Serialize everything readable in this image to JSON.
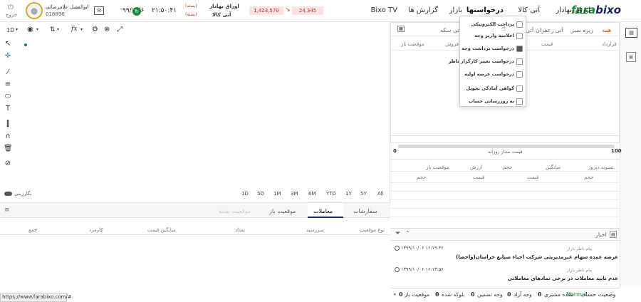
{
  "brand": {
    "part1": "fara",
    "part2": "bixo"
  },
  "menu": [
    {
      "label": "اوراق بهادار"
    },
    {
      "label": "آتی کالا"
    },
    {
      "label": "درخواستها"
    },
    {
      "label": "بازار"
    },
    {
      "label": "گزارش ها"
    },
    {
      "label": "Bixo TV"
    }
  ],
  "ticker": {
    "name1": "اوراق بهادار",
    "name2": "آتی کالا",
    "tag1": "(بسته)",
    "tag2": "(بسته)",
    "value1": "24,345",
    "value2": "1,423,570"
  },
  "clock": {
    "time": "۲۱:۵۰:۴۱",
    "date": "۹۹/۱۰/۶"
  },
  "user": {
    "name": "ابوالفضل علامرضائی",
    "code": "018896",
    "logout": "خروج"
  },
  "dropdown": {
    "items": [
      {
        "label": "پرداخت الکترونیکی"
      },
      {
        "label": "اعلامیه واریز وجه"
      },
      {
        "label": "درخواست برداشت وجه"
      },
      {
        "label": "درخواست تغییر کارگزار ناظر"
      },
      {
        "label": "درخواست عرضه اولیه"
      },
      {
        "label": "گواهی آمادگی تحویل"
      },
      {
        "label": "به روزرسانی حساب"
      }
    ]
  },
  "contract_panel": {
    "tabs": [
      "همه",
      "زیره سبز",
      "آتی زعفران",
      "آتی",
      "آتی سکه"
    ],
    "headers": [
      "قرارداد",
      "قیمت",
      "فروش",
      "موقعیت باز"
    ]
  },
  "chart": {
    "toolbar": {
      "interval": "1D",
      "fx": "fx"
    },
    "timeframes": [
      "All",
      "5Y",
      "1Y",
      "YTD",
      "6M",
      "3M",
      "1M",
      "5D",
      "1D"
    ],
    "draw_mode": "نگارزینی"
  },
  "margin": {
    "left_value": "0",
    "right_value": "100",
    "label": "قیمت مجاز روزانه"
  },
  "settle_table": {
    "row1": [
      "تسویه دیروز",
      "میانگین",
      "حجم",
      "ارزش",
      "موقعیت باز"
    ],
    "row2": [
      "حجم",
      "قیمت",
      "قیمت",
      "حجم"
    ]
  },
  "orders": {
    "tabs": [
      "سفارشات",
      "معاملات",
      "موقعیت باز",
      "موقعیت بسته"
    ],
    "headers": [
      "نوع موقعیت",
      "سررسید",
      "تعداد",
      "میانگین قیمت",
      "کارمزد",
      "جمع"
    ]
  },
  "news": {
    "title": "اخبار",
    "items": [
      {
        "source": "پیام ناظر بازار",
        "time": "۱۳۹۹/۱۰/۰۶ ۱۶:۱۹:۴۶",
        "headline": "عرضه عمده سهام غیرمدیریتی شرکت احیاء صنایع خراسان(واحصا)"
      },
      {
        "source": "پیام ناظر بازار",
        "time": "۱۳۹۹/۱۰/۰۶ ۱۶:۱۳:۵۶",
        "headline": "عدم تایید معاملات در برخی نمادهای معاملاتی"
      }
    ]
  },
  "status": {
    "account_label": "وضعیت حساب",
    "account_value": "Normal",
    "credit_label": "مانده مشتری",
    "credit_value": "0",
    "free_label": "وجه آزاد",
    "free_value": "0",
    "guarantee_label": "وجه تضمین",
    "guarantee_value": "0",
    "blocked_label": "بلوکه شده",
    "blocked_value": "0",
    "open_label": "موقعیت باز",
    "open_value": "0"
  },
  "url": "https://www.farabixo.com/#",
  "colors": {
    "brand_green": "#1b8a3c",
    "brand_navy": "#1a2a5e",
    "accent_orange": "#d65a00",
    "ticker_red": "#d9342b"
  }
}
